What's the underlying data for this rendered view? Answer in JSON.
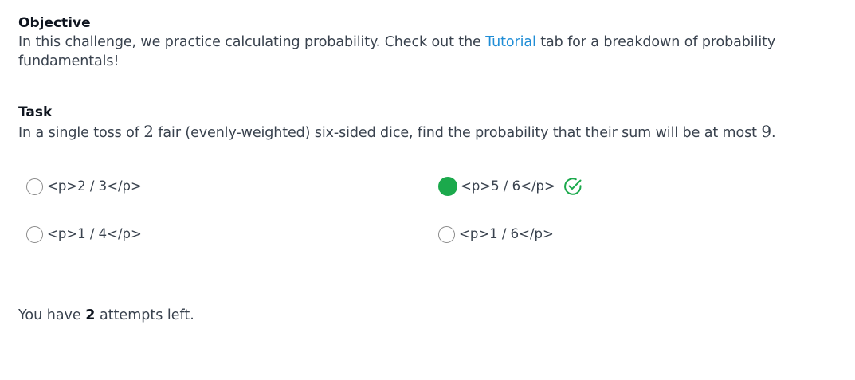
{
  "objective": {
    "heading": "Objective",
    "text_before": "In this challenge, we practice calculating probability. Check out the ",
    "link": "Tutorial",
    "text_after": " tab for a breakdown of probability fundamentals!"
  },
  "task": {
    "heading": "Task",
    "text_1": "In a single toss of ",
    "num_dice": "2",
    "text_2": " fair (evenly-weighted) six-sided dice, find the probability that their sum will be at most ",
    "max_sum": "9",
    "text_3": "."
  },
  "options": [
    {
      "label": "<p>2 / 3</p>",
      "selected": false
    },
    {
      "label": "<p>5 / 6</p>",
      "selected": true,
      "correct": true
    },
    {
      "label": "<p>1 / 4</p>",
      "selected": false
    },
    {
      "label": "<p>1 / 6</p>",
      "selected": false
    }
  ],
  "attempts": {
    "prefix": "You have ",
    "count": "2",
    "suffix": " attempts left."
  },
  "colors": {
    "link": "#1f8dd6",
    "selected": "#1ba94c",
    "text": "#39424e"
  },
  "icons": {
    "correct": "check-circle-icon"
  }
}
